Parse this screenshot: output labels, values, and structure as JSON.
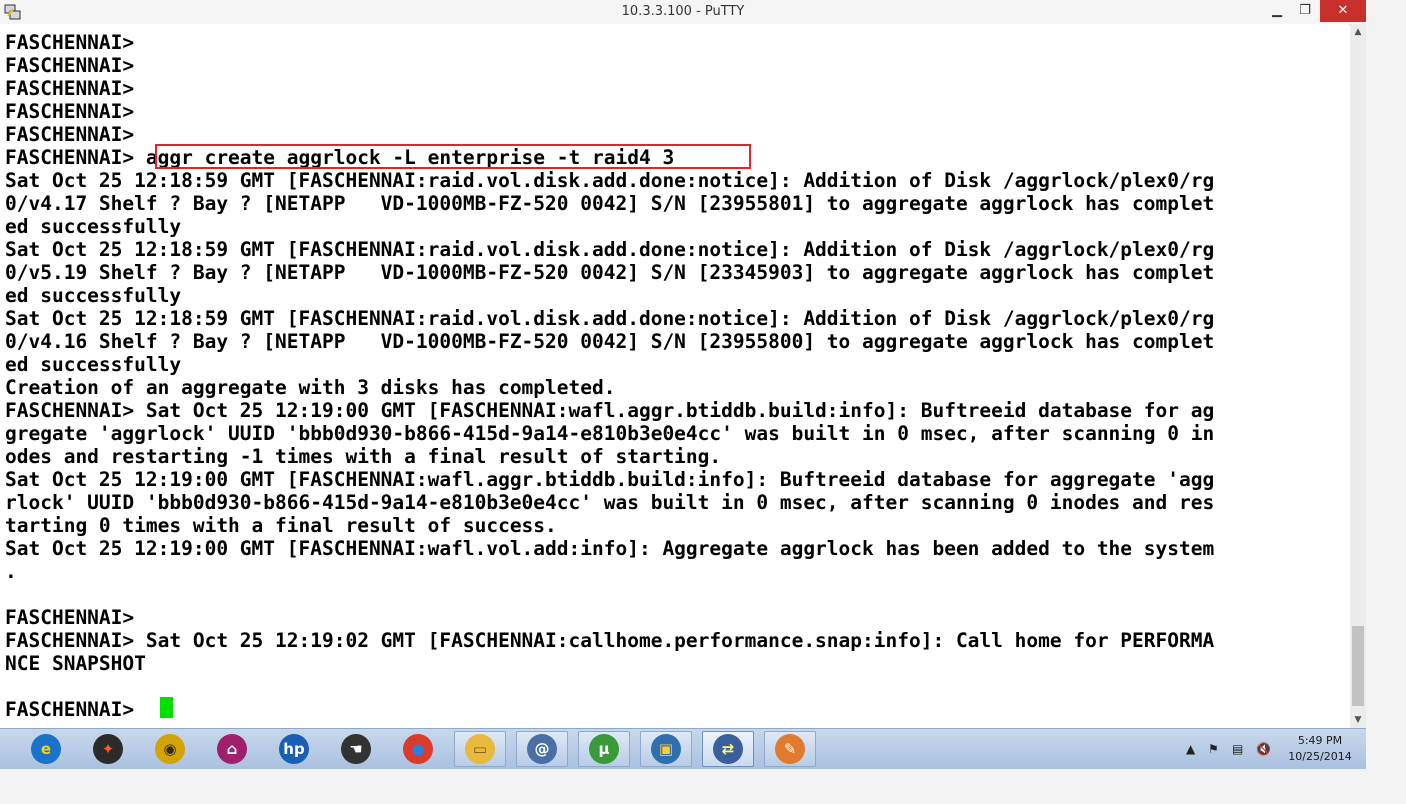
{
  "window": {
    "title": "10.3.3.100 - PuTTY"
  },
  "terminal": {
    "lines": [
      "FASCHENNAI>",
      "FASCHENNAI>",
      "FASCHENNAI>",
      "FASCHENNAI>",
      "FASCHENNAI>",
      "FASCHENNAI> aggr create aggrlock -L enterprise -t raid4 3",
      "Sat Oct 25 12:18:59 GMT [FASCHENNAI:raid.vol.disk.add.done:notice]: Addition of Disk /aggrlock/plex0/rg",
      "0/v4.17 Shelf ? Bay ? [NETAPP   VD-1000MB-FZ-520 0042] S/N [23955801] to aggregate aggrlock has complet",
      "ed successfully",
      "Sat Oct 25 12:18:59 GMT [FASCHENNAI:raid.vol.disk.add.done:notice]: Addition of Disk /aggrlock/plex0/rg",
      "0/v5.19 Shelf ? Bay ? [NETAPP   VD-1000MB-FZ-520 0042] S/N [23345903] to aggregate aggrlock has complet",
      "ed successfully",
      "Sat Oct 25 12:18:59 GMT [FASCHENNAI:raid.vol.disk.add.done:notice]: Addition of Disk /aggrlock/plex0/rg",
      "0/v4.16 Shelf ? Bay ? [NETAPP   VD-1000MB-FZ-520 0042] S/N [23955800] to aggregate aggrlock has complet",
      "ed successfully",
      "Creation of an aggregate with 3 disks has completed.",
      "FASCHENNAI> Sat Oct 25 12:19:00 GMT [FASCHENNAI:wafl.aggr.btiddb.build:info]: Buftreeid database for ag",
      "gregate 'aggrlock' UUID 'bbb0d930-b866-415d-9a14-e810b3e0e4cc' was built in 0 msec, after scanning 0 in",
      "odes and restarting -1 times with a final result of starting.",
      "Sat Oct 25 12:19:00 GMT [FASCHENNAI:wafl.aggr.btiddb.build:info]: Buftreeid database for aggregate 'agg",
      "rlock' UUID 'bbb0d930-b866-415d-9a14-e810b3e0e4cc' was built in 0 msec, after scanning 0 inodes and res",
      "tarting 0 times with a final result of success.",
      "Sat Oct 25 12:19:00 GMT [FASCHENNAI:wafl.vol.add:info]: Aggregate aggrlock has been added to the system",
      ".",
      "",
      "FASCHENNAI>",
      "FASCHENNAI> Sat Oct 25 12:19:02 GMT [FASCHENNAI:callhome.performance.snap:info]: Call home for PERFORMA",
      "NCE SNAPSHOT",
      "",
      "FASCHENNAI>"
    ],
    "cursor_color": "#00e000",
    "highlight_color": "#e0262b"
  },
  "taskbar": {
    "items": [
      {
        "name": "internet-explorer-icon",
        "glyph": "e",
        "bg": "#1a73c9",
        "fg": "#ffd200"
      },
      {
        "name": "app-mosaic-icon",
        "glyph": "✦",
        "bg": "#2b2b2b",
        "fg": "#ff5a1f"
      },
      {
        "name": "media-player-icon",
        "glyph": "◉",
        "bg": "#d4a300",
        "fg": "#2b2b2b"
      },
      {
        "name": "remote-access-icon",
        "glyph": "⌂",
        "bg": "#a0206e",
        "fg": "#ffffff"
      },
      {
        "name": "hp-icon",
        "glyph": "hp",
        "bg": "#1a5fb4",
        "fg": "#ffffff"
      },
      {
        "name": "tool-app-icon",
        "glyph": "☚",
        "bg": "#333333",
        "fg": "#ffffff"
      },
      {
        "name": "chrome-icon",
        "glyph": "●",
        "bg": "#db3b2b",
        "fg": "#2a7de1"
      },
      {
        "name": "file-explorer-icon",
        "glyph": "▭",
        "bg": "#e8b93c",
        "fg": "#7a5a10"
      },
      {
        "name": "network-app-icon",
        "glyph": "@",
        "bg": "#4a6fa5",
        "fg": "#ffffff"
      },
      {
        "name": "utorrent-icon",
        "glyph": "µ",
        "bg": "#3a9a3a",
        "fg": "#ffffff"
      },
      {
        "name": "virtualbox-icon",
        "glyph": "▣",
        "bg": "#2f6fb0",
        "fg": "#ffcc33"
      },
      {
        "name": "putty-icon",
        "glyph": "⇄",
        "bg": "#3a5f9a",
        "fg": "#ffff66"
      },
      {
        "name": "paint-icon",
        "glyph": "✎",
        "bg": "#e07a2f",
        "fg": "#ffffff"
      }
    ],
    "clock_time": "5:49 PM",
    "clock_date": "10/25/2014"
  }
}
